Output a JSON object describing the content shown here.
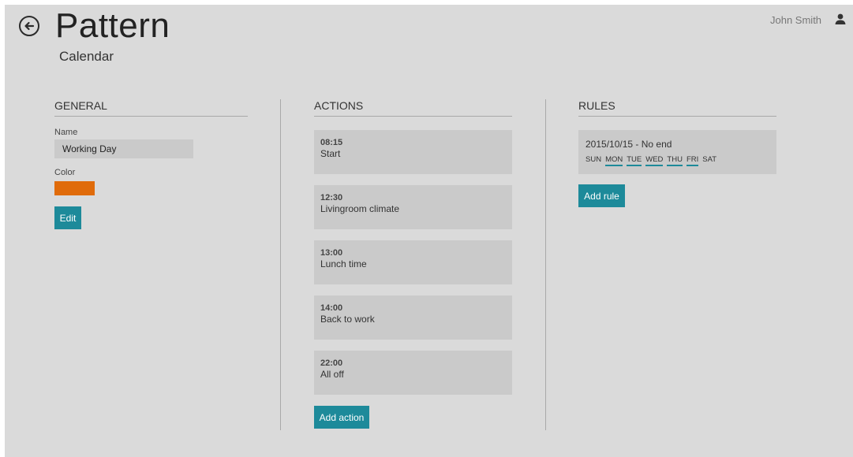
{
  "header": {
    "title": "Pattern",
    "subtitle": "Calendar",
    "user_name": "John Smith"
  },
  "general": {
    "heading": "GENERAL",
    "name_label": "Name",
    "name_value": "Working Day",
    "color_label": "Color",
    "color_value": "#e06b0a",
    "edit_label": "Edit"
  },
  "actions": {
    "heading": "ACTIONS",
    "items": [
      {
        "time": "08:15",
        "text": "Start"
      },
      {
        "time": "12:30",
        "text": "Livingroom climate"
      },
      {
        "time": "13:00",
        "text": "Lunch time"
      },
      {
        "time": "14:00",
        "text": "Back to work"
      },
      {
        "time": "22:00",
        "text": "All off"
      }
    ],
    "add_label": "Add action"
  },
  "rules": {
    "heading": "RULES",
    "items": [
      {
        "range": "2015/10/15 - No end",
        "days": [
          {
            "label": "SUN",
            "active": false
          },
          {
            "label": "MON",
            "active": true
          },
          {
            "label": "TUE",
            "active": true
          },
          {
            "label": "WED",
            "active": true
          },
          {
            "label": "THU",
            "active": true
          },
          {
            "label": "FRI",
            "active": true
          },
          {
            "label": "SAT",
            "active": false
          }
        ]
      }
    ],
    "add_label": "Add rule"
  },
  "colors": {
    "accent": "#1d8a9a",
    "background": "#dadada",
    "card": "#cacaca"
  }
}
